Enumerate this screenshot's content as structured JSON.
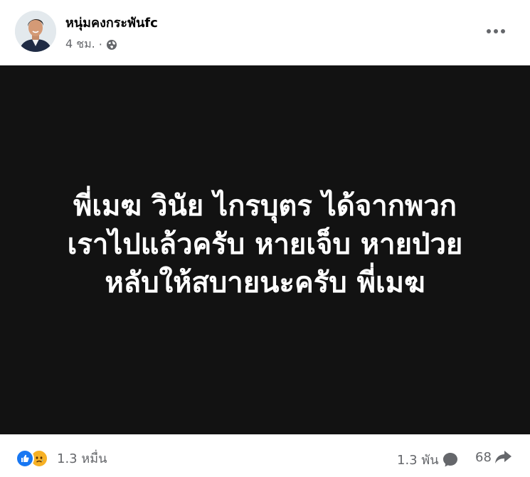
{
  "post": {
    "author": "หนุ่มคงกระพันfc",
    "time": "4 ชม.",
    "separator": "·",
    "image_text": "พี่เมฆ วินัย ไกรบุตร ได้จากพวกเราไปแล้วครับ หายเจ็บ หายป่วย หลับให้สบายนะครับ พี่เมฆ",
    "image_lines": [
      "พี่เมฆ วินัย ไกรบุตร ได้จากพวก",
      "เราไปแล้วครับ หายเจ็บ หายป่วย",
      "หลับให้สบายนะครับ พี่เมฆ"
    ]
  },
  "footer": {
    "reactions_count": "1.3 หมื่น",
    "comments_count": "1.3 พัน",
    "shares_count": "68"
  },
  "icons": {
    "globe": "globe-icon",
    "more": "more-horizontal-icon",
    "like": "like-icon",
    "sad": "sad-icon",
    "comment": "comment-icon",
    "share": "share-icon"
  },
  "colors": {
    "image_background": "#121212",
    "like_blue": "#1877f2",
    "sad_yellow": "#f7b125",
    "meta_gray": "#65676b",
    "name_black": "#050505"
  }
}
